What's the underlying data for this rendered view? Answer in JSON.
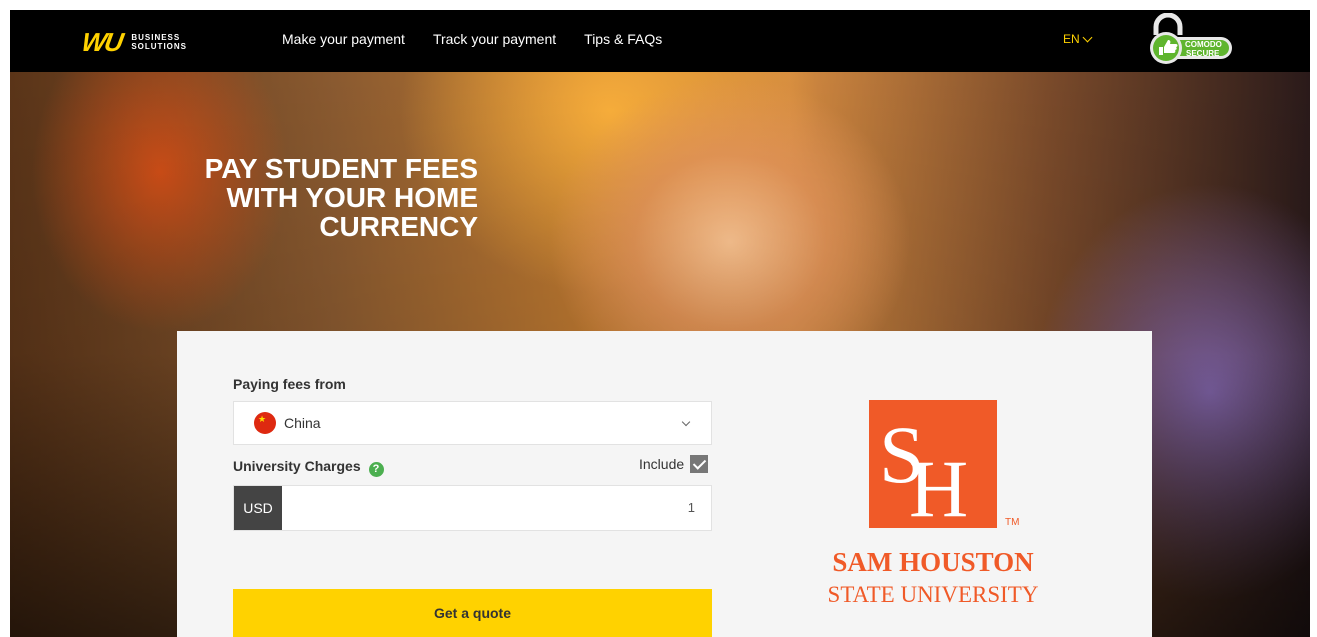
{
  "header": {
    "logo_mark": "WU",
    "logo_line1": "BUSINESS",
    "logo_line2": "SOLUTIONS",
    "nav": [
      "Make your payment",
      "Track your payment",
      "Tips & FAQs"
    ],
    "language": "EN",
    "badge_line1": "COMODO",
    "badge_line2": "SECURE"
  },
  "hero": {
    "title_line1": "PAY STUDENT FEES",
    "title_line2": "WITH YOUR HOME",
    "title_line3": "CURRENCY"
  },
  "form": {
    "paying_from_label": "Paying fees from",
    "country": "China",
    "charges_label": "University Charges",
    "help_icon": "?",
    "include_label": "Include",
    "include_checked": true,
    "currency": "USD",
    "amount": "1",
    "quote_button": "Get a quote"
  },
  "university": {
    "monogram_s": "S",
    "monogram_h": "H",
    "tm": "TM",
    "name_line1": "SAM HOUSTON",
    "name_line2": "STATE UNIVERSITY"
  },
  "colors": {
    "brand_yellow": "#ffd200",
    "university_orange": "#f05a28",
    "header_bg": "#000000"
  }
}
